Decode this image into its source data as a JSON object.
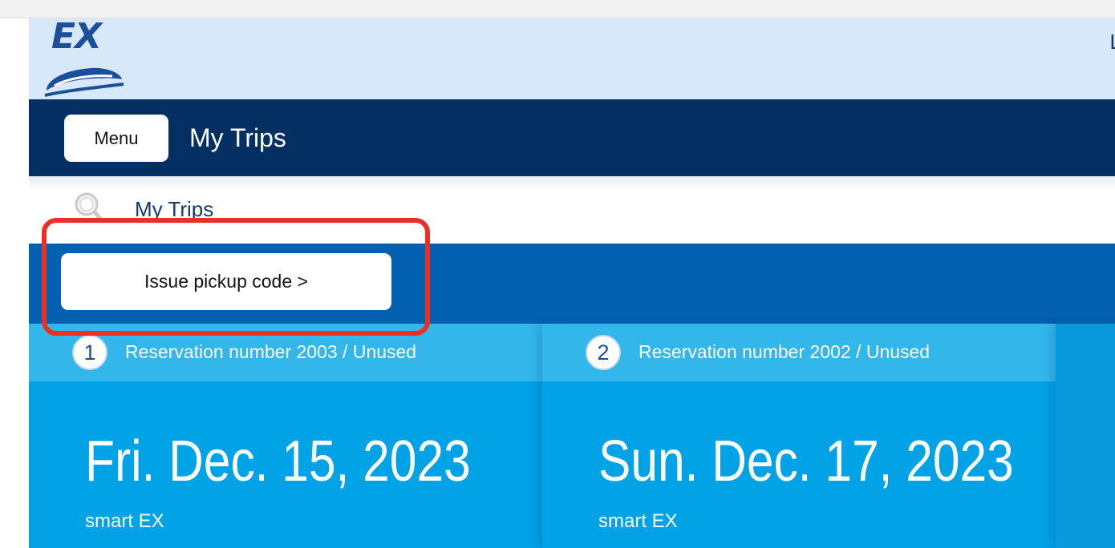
{
  "header": {
    "logo_text": "EX",
    "right_text": "L"
  },
  "nav": {
    "menu_label": "Menu",
    "title": "My Trips"
  },
  "breadcrumb": {
    "label": "My Trips"
  },
  "actions": {
    "issue_pickup_label": "Issue pickup code >"
  },
  "reservations": [
    {
      "index": "1",
      "reference": "Reservation number 2003 / Unused",
      "date": "Fri. Dec. 15, 2023",
      "service": "smart EX"
    },
    {
      "index": "2",
      "reference": "Reservation number 2002 / Unused",
      "date": "Sun. Dec. 17, 2023",
      "service": "smart EX"
    }
  ],
  "colors": {
    "header_bg": "#d7e9f8",
    "nav_bg": "#032f63",
    "action_band_bg": "#0460b0",
    "card_bg": "#02a2e6",
    "card_head_bg": "#33b7eb",
    "highlight": "#ee2e24"
  },
  "icons": {
    "logo": "ex-train-logo",
    "breadcrumb": "search-icon"
  }
}
